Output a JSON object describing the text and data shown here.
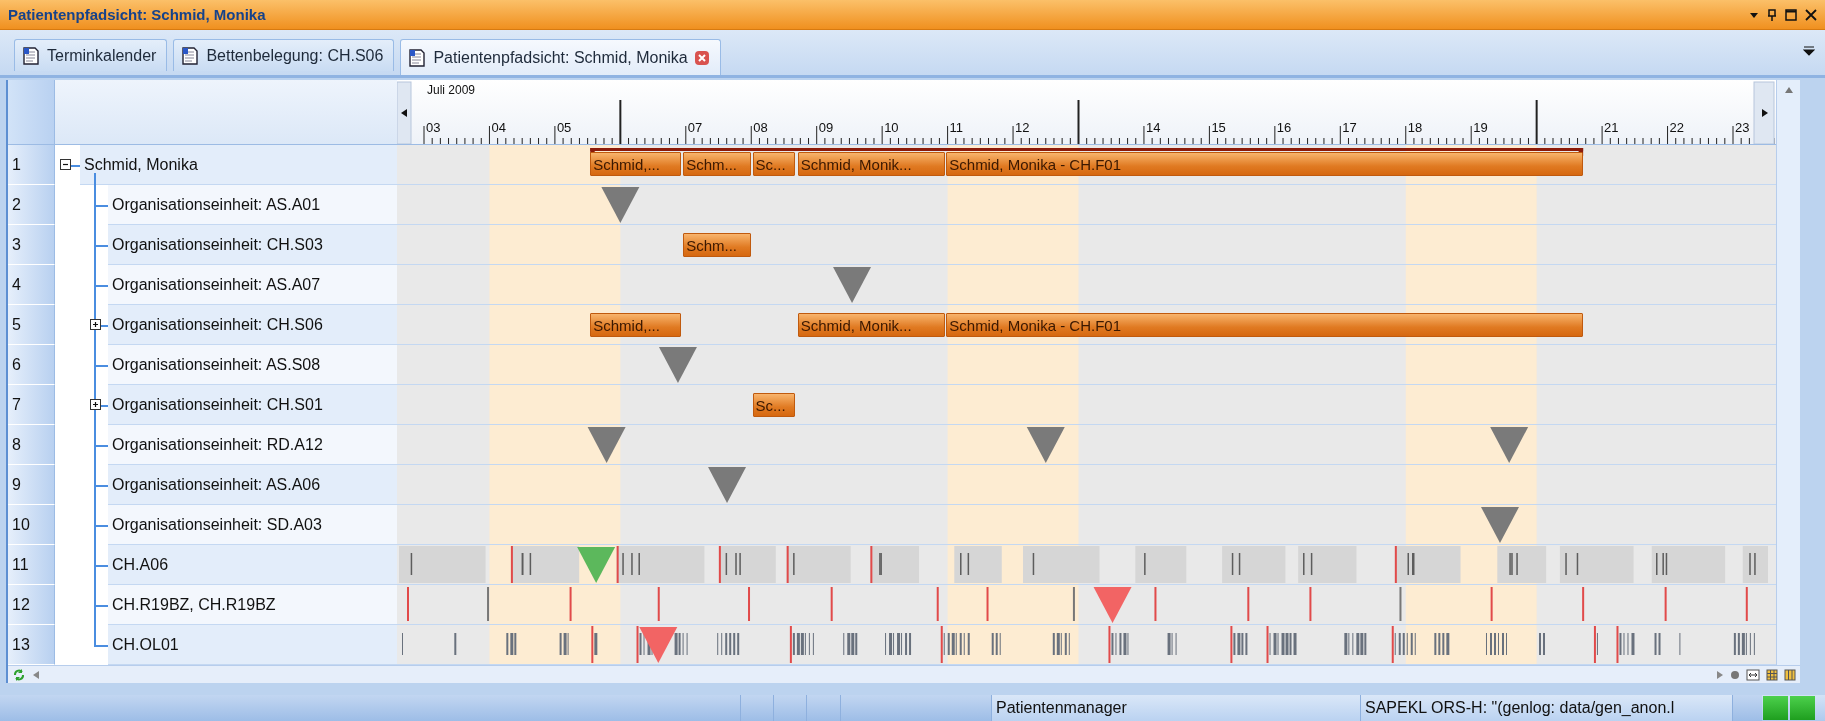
{
  "window": {
    "title": "Patientenpfadsicht: Schmid, Monika"
  },
  "tabs": [
    {
      "label": "Terminkalender",
      "selected": false
    },
    {
      "label": "Bettenbelegung: CH.S06",
      "selected": false
    },
    {
      "label": "Patientenpfadsicht: Schmid, Monika",
      "selected": true
    }
  ],
  "timeline": {
    "month": "Juli 2009",
    "days": [
      {
        "kind": "day",
        "label": "03"
      },
      {
        "kind": "day",
        "label": "04"
      },
      {
        "kind": "day",
        "label": "05"
      },
      {
        "kind": "week"
      },
      {
        "kind": "day",
        "label": "07"
      },
      {
        "kind": "day",
        "label": "08"
      },
      {
        "kind": "day",
        "label": "09"
      },
      {
        "kind": "day",
        "label": "10"
      },
      {
        "kind": "day",
        "label": "11"
      },
      {
        "kind": "day",
        "label": "12"
      },
      {
        "kind": "week"
      },
      {
        "kind": "day",
        "label": "14"
      },
      {
        "kind": "day",
        "label": "15"
      },
      {
        "kind": "day",
        "label": "16"
      },
      {
        "kind": "day",
        "label": "17"
      },
      {
        "kind": "day",
        "label": "18"
      },
      {
        "kind": "day",
        "label": "19"
      },
      {
        "kind": "week"
      },
      {
        "kind": "day",
        "label": "21"
      },
      {
        "kind": "day",
        "label": "22"
      },
      {
        "kind": "day",
        "label": "23"
      }
    ]
  },
  "tree": {
    "number": "1",
    "label": "Schmid, Monika",
    "expanded": true,
    "lane": {
      "kind": "summary",
      "bars": [
        {
          "label": "Schmid,..."
        },
        {
          "label": "Schm..."
        },
        {
          "label": "Sc..."
        },
        {
          "label": "Schmid, Monik..."
        },
        {
          "label": "Schmid, Monika - CH.F01"
        }
      ]
    },
    "children": [
      {
        "number": "2",
        "label": "Organisationseinheit: AS.A01",
        "collapsed": false,
        "lane": {
          "kind": "schedule",
          "markers": [
            {
              "color": "#7a7a7a"
            }
          ]
        }
      },
      {
        "number": "3",
        "label": "Organisationseinheit: CH.S03",
        "collapsed": false,
        "lane": {
          "kind": "schedule",
          "bars": [
            {
              "label": "Schm..."
            }
          ]
        }
      },
      {
        "number": "4",
        "label": "Organisationseinheit: AS.A07",
        "collapsed": false,
        "lane": {
          "kind": "schedule",
          "markers": [
            {
              "color": "#7a7a7a"
            }
          ]
        }
      },
      {
        "number": "5",
        "label": "Organisationseinheit: CH.S06",
        "collapsed": true,
        "lane": {
          "kind": "schedule",
          "bars": [
            {
              "label": "Schmid,..."
            },
            {
              "label": "Schmid, Monik..."
            },
            {
              "label": "Schmid, Monika - CH.F01"
            }
          ]
        }
      },
      {
        "number": "6",
        "label": "Organisationseinheit: AS.S08",
        "collapsed": false,
        "lane": {
          "kind": "schedule",
          "markers": [
            {
              "color": "#7a7a7a"
            }
          ]
        }
      },
      {
        "number": "7",
        "label": "Organisationseinheit: CH.S01",
        "collapsed": true,
        "lane": {
          "kind": "schedule",
          "bars": [
            {
              "label": "Sc..."
            }
          ]
        }
      },
      {
        "number": "8",
        "label": "Organisationseinheit: RD.A12",
        "collapsed": false,
        "lane": {
          "kind": "schedule",
          "markers": [
            {
              "color": "#7a7a7a"
            },
            {
              "color": "#7a7a7a"
            },
            {
              "color": "#7a7a7a"
            }
          ]
        }
      },
      {
        "number": "9",
        "label": "Organisationseinheit: AS.A06",
        "collapsed": false,
        "lane": {
          "kind": "schedule",
          "markers": [
            {
              "color": "#7a7a7a"
            }
          ]
        }
      },
      {
        "number": "10",
        "label": "Organisationseinheit: SD.A03",
        "collapsed": false,
        "lane": {
          "kind": "schedule",
          "markers": [
            {
              "color": "#7a7a7a"
            }
          ]
        }
      },
      {
        "number": "11",
        "label": "CH.A06",
        "collapsed": false,
        "lane": {
          "kind": "occupancy",
          "markers": [
            {
              "color": "#5cb85c"
            }
          ]
        }
      },
      {
        "number": "12",
        "label": "CH.R19BZ, CH.R19BZ",
        "collapsed": false,
        "lane": {
          "kind": "events",
          "markers": [
            {
              "color": "#f26464"
            }
          ]
        }
      },
      {
        "number": "13",
        "label": "CH.OL01",
        "collapsed": false,
        "lane": {
          "kind": "dense",
          "markers": [
            {
              "color": "#f26464"
            }
          ]
        }
      }
    ]
  },
  "status_bar": {
    "items": [
      {
        "text": "Patientenmanager"
      },
      {
        "text": "SAPEKL ORS-H: \"(genlog: data/gen_anon.l"
      }
    ]
  }
}
